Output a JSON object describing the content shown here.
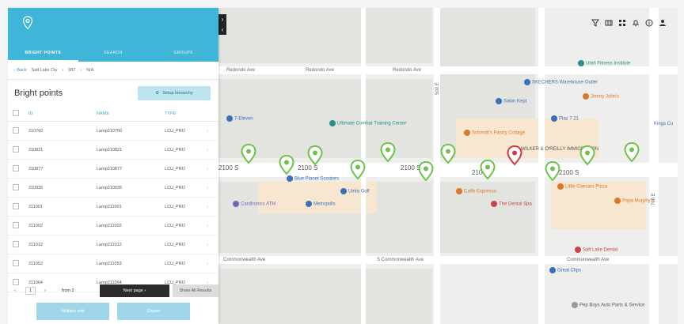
{
  "panel": {
    "tabs": [
      "BRIGHT POINTS",
      "SEARCH",
      "GROUPS"
    ],
    "breadcrumb": {
      "back": "Back",
      "items": [
        "Salt Lake Cty",
        "987",
        "N/A"
      ]
    },
    "title": "Bright points",
    "setup_label": "Setup hierarchy",
    "columns": [
      "ID",
      "NAME",
      "TYPE"
    ],
    "rows": [
      {
        "id": "210760",
        "name": "Lamp210760",
        "type": "LCU_PRO"
      },
      {
        "id": "210821",
        "name": "Lamp210821",
        "type": "LCU_PRO"
      },
      {
        "id": "210877",
        "name": "Lamp210877",
        "type": "LCU_PRO"
      },
      {
        "id": "210935",
        "name": "Lamp210935",
        "type": "LCU_PRO"
      },
      {
        "id": "211001",
        "name": "Lamp211001",
        "type": "LCU_PRO"
      },
      {
        "id": "211002",
        "name": "Lamp211002",
        "type": "LCU_PRO"
      },
      {
        "id": "211012",
        "name": "Lamp211012",
        "type": "LCU_PRO"
      },
      {
        "id": "211053",
        "name": "Lamp211053",
        "type": "LCU_PRO"
      },
      {
        "id": "211064",
        "name": "Lamp211064",
        "type": "LCU_PRO"
      }
    ],
    "pager": {
      "page": "1",
      "of": "from 2",
      "next": "Next page",
      "show_all": "Show All Results"
    },
    "multiple_edit": "Multiple edit",
    "export": "Export"
  },
  "map": {
    "streets": [
      "Redondo Ave",
      "Redondo Ave",
      "Redondo Ave",
      "2100 S",
      "2100 S",
      "2100 S",
      "2100 S",
      "2100 S",
      "Commonwealth Ave",
      "S Commonwealth Ave",
      "Commonwealth Ave",
      "700 E",
      "500 E"
    ],
    "pois": [
      {
        "text": "7-Eleven",
        "color": "#3b6fb6"
      },
      {
        "text": "Ultimate Combat Training Center",
        "color": "#2a8f87"
      },
      {
        "text": "Blue Planet Scooters",
        "color": "#3b6fb6"
      },
      {
        "text": "Uinta Golf",
        "color": "#3b6fb6"
      },
      {
        "text": "Cardtronics ATM",
        "color": "#7b62b8"
      },
      {
        "text": "Metropolis",
        "color": "#3b6fb6"
      },
      {
        "text": "Utah Fitness Institute",
        "color": "#2a8f87"
      },
      {
        "text": "SKECHERS Warehouse Outlet",
        "color": "#3b6fb6"
      },
      {
        "text": "Jimmy John's",
        "color": "#d8782a"
      },
      {
        "text": "Salon Kept",
        "color": "#3b6fb6"
      },
      {
        "text": "Schmidt's Pastry Cottage",
        "color": "#d8782a"
      },
      {
        "text": "Plaz 7 21",
        "color": "#3b6fb6"
      },
      {
        "text": "WILKER & O'REILLY IMMIGRATION",
        "color": "#555555"
      },
      {
        "text": "Caffe Expresso",
        "color": "#d8782a"
      },
      {
        "text": "The Dental Spa",
        "color": "#c54747"
      },
      {
        "text": "Little Caesars Pizza",
        "color": "#d8782a"
      },
      {
        "text": "Papa Murphy's",
        "color": "#d8782a"
      },
      {
        "text": "Salt Lake Dental",
        "color": "#c54747"
      },
      {
        "text": "Great Clips",
        "color": "#3b6fb6"
      },
      {
        "text": "Pep Boys Auto Parts & Service",
        "color": "#555555"
      },
      {
        "text": "Kings Cu",
        "color": "#3b6fb6"
      }
    ],
    "accent": "#3fb6d8",
    "marker_green": "#6cc24a",
    "marker_red": "#d9363e"
  }
}
